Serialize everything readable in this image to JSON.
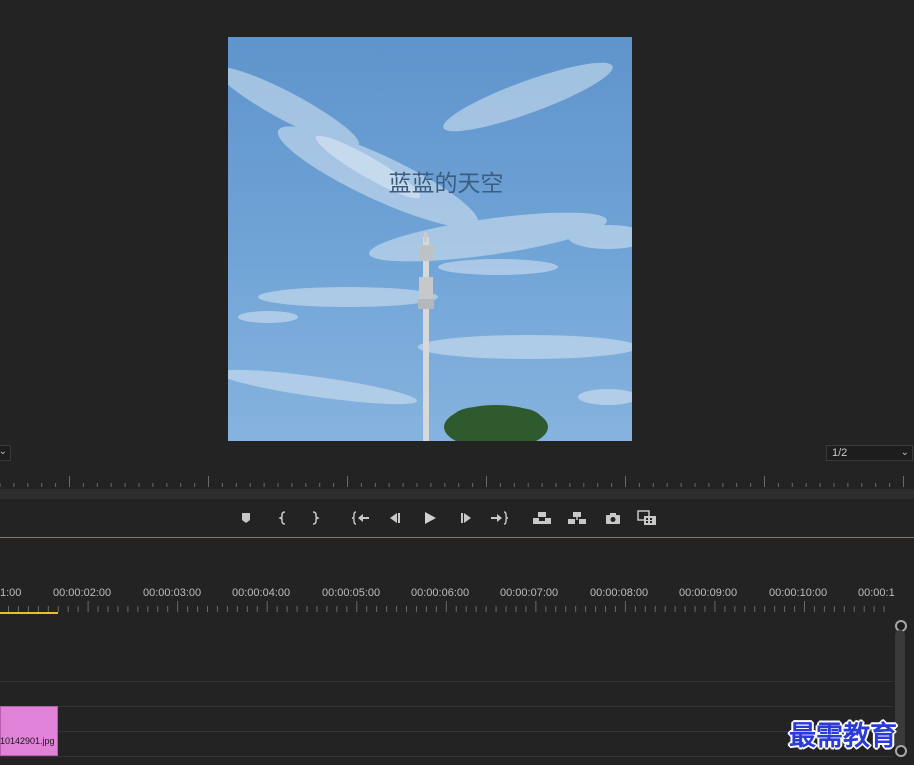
{
  "monitor": {
    "frame_title": "蓝蓝的天空",
    "fit_dropdown": "",
    "resolution_dropdown": "1/2"
  },
  "transport": [
    {
      "name": "add-marker",
      "icon": "marker-icon"
    },
    {
      "name": "mark-in",
      "icon": "mark-in-icon"
    },
    {
      "name": "mark-out",
      "icon": "mark-out-icon"
    },
    {
      "name": "go-to-in",
      "icon": "go-to-in-icon"
    },
    {
      "name": "step-back",
      "icon": "step-back-icon"
    },
    {
      "name": "play",
      "icon": "play-icon"
    },
    {
      "name": "step-forward",
      "icon": "step-forward-icon"
    },
    {
      "name": "go-to-out",
      "icon": "go-to-out-icon"
    },
    {
      "name": "lift",
      "icon": "lift-icon"
    },
    {
      "name": "extract",
      "icon": "extract-icon"
    },
    {
      "name": "export-frame",
      "icon": "camera-icon"
    },
    {
      "name": "compare-view",
      "icon": "compare-icon"
    }
  ],
  "timeline": {
    "timecodes": [
      "1:00",
      "00:00:02:00",
      "00:00:03:00",
      "00:00:04:00",
      "00:00:05:00",
      "00:00:06:00",
      "00:00:07:00",
      "00:00:08:00",
      "00:00:09:00",
      "00:00:10:00",
      "00:00:1"
    ],
    "clip_label": "10142901.jpg",
    "clip_color": "#e082d8",
    "playhead_color": "#e6c420"
  },
  "watermark": "最需教育"
}
